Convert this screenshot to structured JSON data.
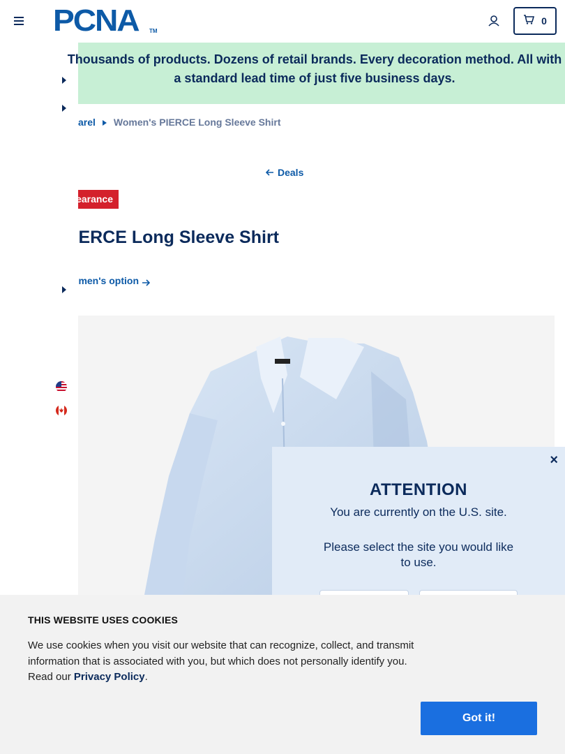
{
  "header": {
    "logo_text": "PCNA",
    "logo_tm": "TM",
    "cart_count": "0"
  },
  "banner": {
    "text": "Thousands of products. Dozens of retail brands. Every decoration method. All with a standard lead time of just five business days."
  },
  "breadcrumb": {
    "parent": "arel",
    "current": "Women's PIERCE Long Sleeve Shirt"
  },
  "back_link": {
    "label": "Deals"
  },
  "badge": {
    "label": "Clearance"
  },
  "product": {
    "title": "Women's PIERCE Long Sleeve Shirt",
    "option_link": "See men's option"
  },
  "sidebar": {
    "flags": [
      "us-flag-icon",
      "canada-flag-icon"
    ]
  },
  "modal": {
    "title": "ATTENTION",
    "line1": "You are currently on the U.S. site.",
    "line2": "Please select the site you would like to use.",
    "close": "×"
  },
  "cookie": {
    "title": "THIS WEBSITE USES COOKIES",
    "body_before": "We use cookies when you visit our website that can recognize, collect, and transmit information that is associated with you, but which does not personally identify you. Read our ",
    "link": "Privacy Policy",
    "body_after": ".",
    "button": "Got it!"
  },
  "colors": {
    "navy": "#0b2a5b",
    "brand_blue": "#0d5aa7",
    "banner_green": "#c7efd5",
    "badge_red": "#d4202c",
    "button_blue": "#1a6fe0"
  }
}
